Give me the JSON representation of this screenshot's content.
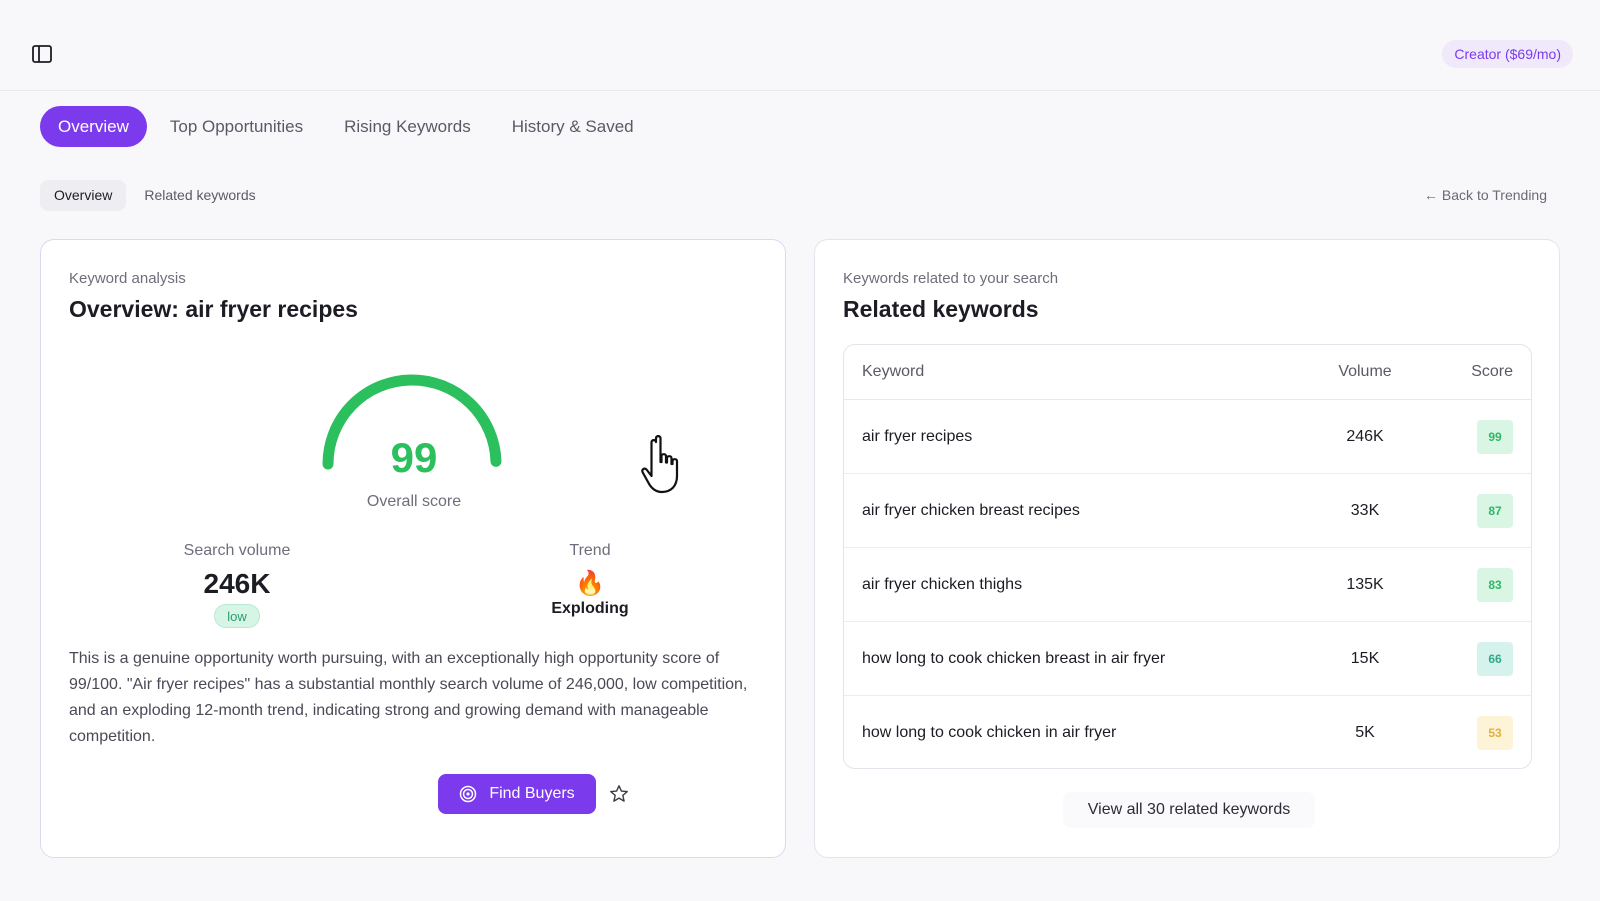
{
  "header": {
    "sidebar_toggle_icon": "sidebar-toggle-icon",
    "plan_badge": "Creator ($69/mo)"
  },
  "main_tabs": [
    {
      "label": "Overview",
      "active": true
    },
    {
      "label": "Top Opportunities",
      "active": false
    },
    {
      "label": "Rising Keywords",
      "active": false
    },
    {
      "label": "History & Saved",
      "active": false
    }
  ],
  "sub_tabs": [
    {
      "label": "Overview",
      "active": true
    },
    {
      "label": "Related keywords",
      "active": false
    }
  ],
  "back_link": "← Back to Trending",
  "overview": {
    "eyebrow": "Keyword analysis",
    "title": "Overview: air fryer recipes",
    "score": "99",
    "score_fraction": 0.99,
    "score_label": "Overall score",
    "search_volume_label": "Search volume",
    "search_volume_value": "246K",
    "competition_badge": "low",
    "trend_label": "Trend",
    "trend_icon": "flame-icon",
    "trend_value": "Exploding",
    "summary": "This is a genuine opportunity worth pursuing, with an exceptionally high opportunity score of 99/100. \"Air fryer recipes\" has a substantial monthly search volume of 246,000, low competition, and an exploding 12-month trend, indicating strong and growing demand with manageable competition.",
    "find_buyers_label": "Find Buyers",
    "save_icon": "star-icon"
  },
  "related": {
    "eyebrow": "Keywords related to your search",
    "title": "Related keywords",
    "columns": {
      "keyword": "Keyword",
      "volume": "Volume",
      "score": "Score"
    },
    "rows": [
      {
        "keyword": "air fryer recipes",
        "volume": "246K",
        "score": "99",
        "chip_bg": "#d9f5e3",
        "chip_fg": "#2fb865"
      },
      {
        "keyword": "air fryer chicken breast recipes",
        "volume": "33K",
        "score": "87",
        "chip_bg": "#d9f5e3",
        "chip_fg": "#2fb865"
      },
      {
        "keyword": "air fryer chicken thighs",
        "volume": "135K",
        "score": "83",
        "chip_bg": "#d9f5e3",
        "chip_fg": "#2fb865"
      },
      {
        "keyword": "how long to cook chicken breast in air fryer",
        "volume": "15K",
        "score": "66",
        "chip_bg": "#d6f2ec",
        "chip_fg": "#2eaa8a"
      },
      {
        "keyword": "how long to cook chicken in air fryer",
        "volume": "5K",
        "score": "53",
        "chip_bg": "#fdf4d8",
        "chip_fg": "#e0b23a"
      }
    ],
    "view_all_label": "View all 30 related keywords"
  },
  "colors": {
    "accent": "#7c3aed",
    "score_green": "#2bbf5e"
  }
}
